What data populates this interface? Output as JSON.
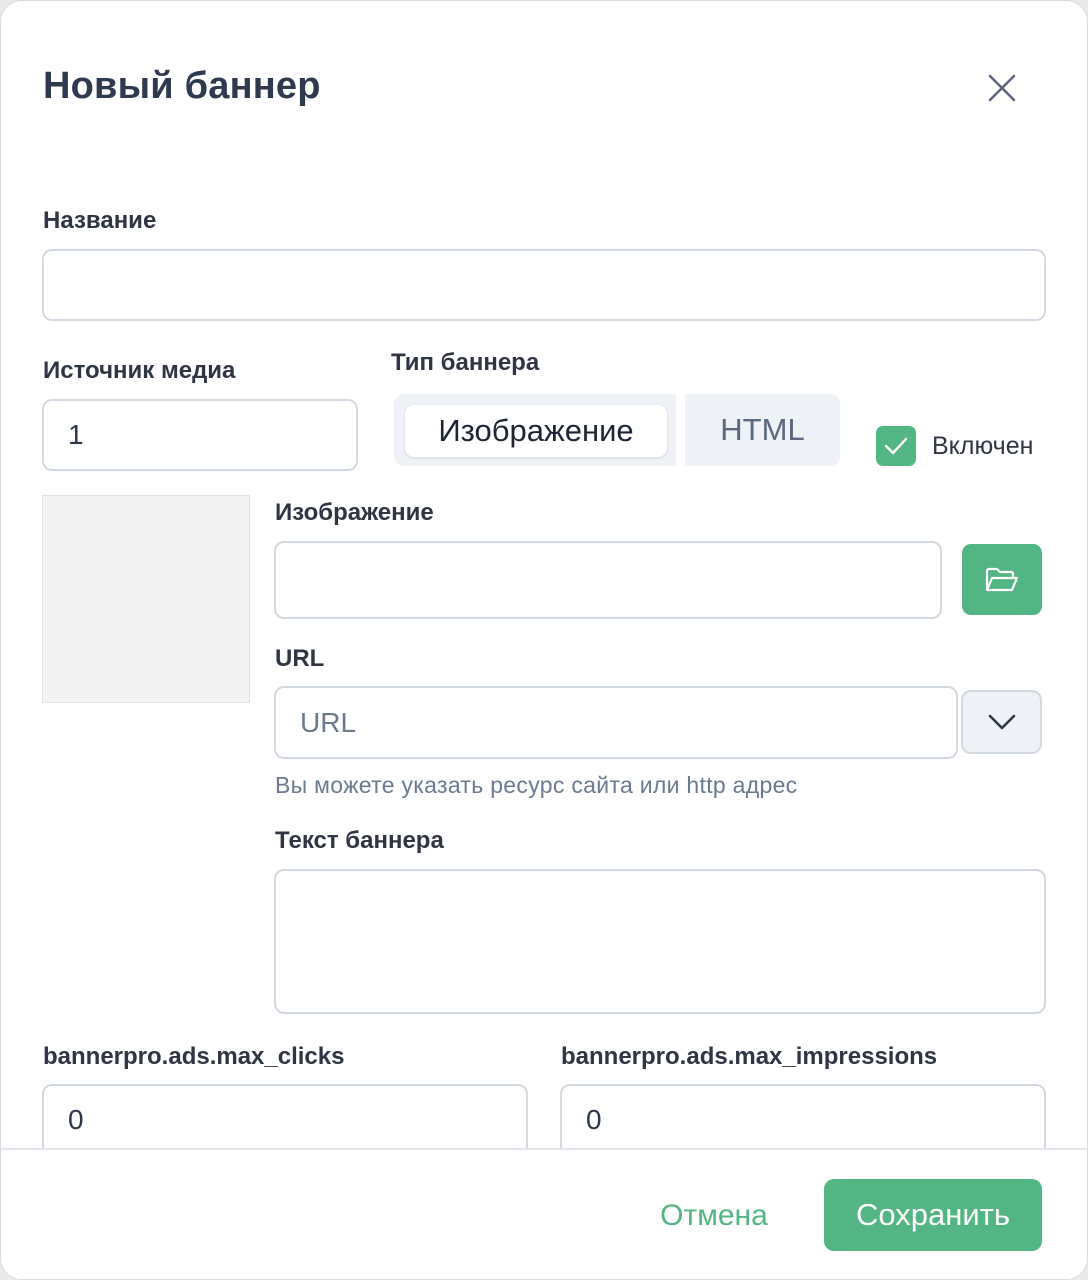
{
  "modal": {
    "title": "Новый баннер",
    "close_icon": "close-icon"
  },
  "fields": {
    "name": {
      "label": "Название",
      "value": ""
    },
    "media_source": {
      "label": "Источник медиа",
      "value": "1"
    },
    "banner_type": {
      "label": "Тип баннера",
      "options": [
        "Изображение",
        "HTML"
      ],
      "selected": "Изображение"
    },
    "enabled": {
      "label": "Включен",
      "checked": true
    },
    "image": {
      "label": "Изображение",
      "value": "",
      "browse_icon": "folder-open-icon"
    },
    "url": {
      "label": "URL",
      "placeholder": "URL",
      "hint": "Вы можете указать ресурс сайта или http адрес",
      "dropdown_icon": "chevron-down-icon"
    },
    "banner_text": {
      "label": "Текст баннера",
      "value": ""
    },
    "max_clicks": {
      "label": "bannerpro.ads.max_clicks",
      "value": "0"
    },
    "max_impressions": {
      "label": "bannerpro.ads.max_impressions",
      "value": "0"
    }
  },
  "footer": {
    "cancel_label": "Отмена",
    "save_label": "Сохранить"
  },
  "colors": {
    "accent": "#52b583",
    "title": "#2f3a4e",
    "border": "#d3d9e2",
    "muted": "#6b7a90"
  }
}
